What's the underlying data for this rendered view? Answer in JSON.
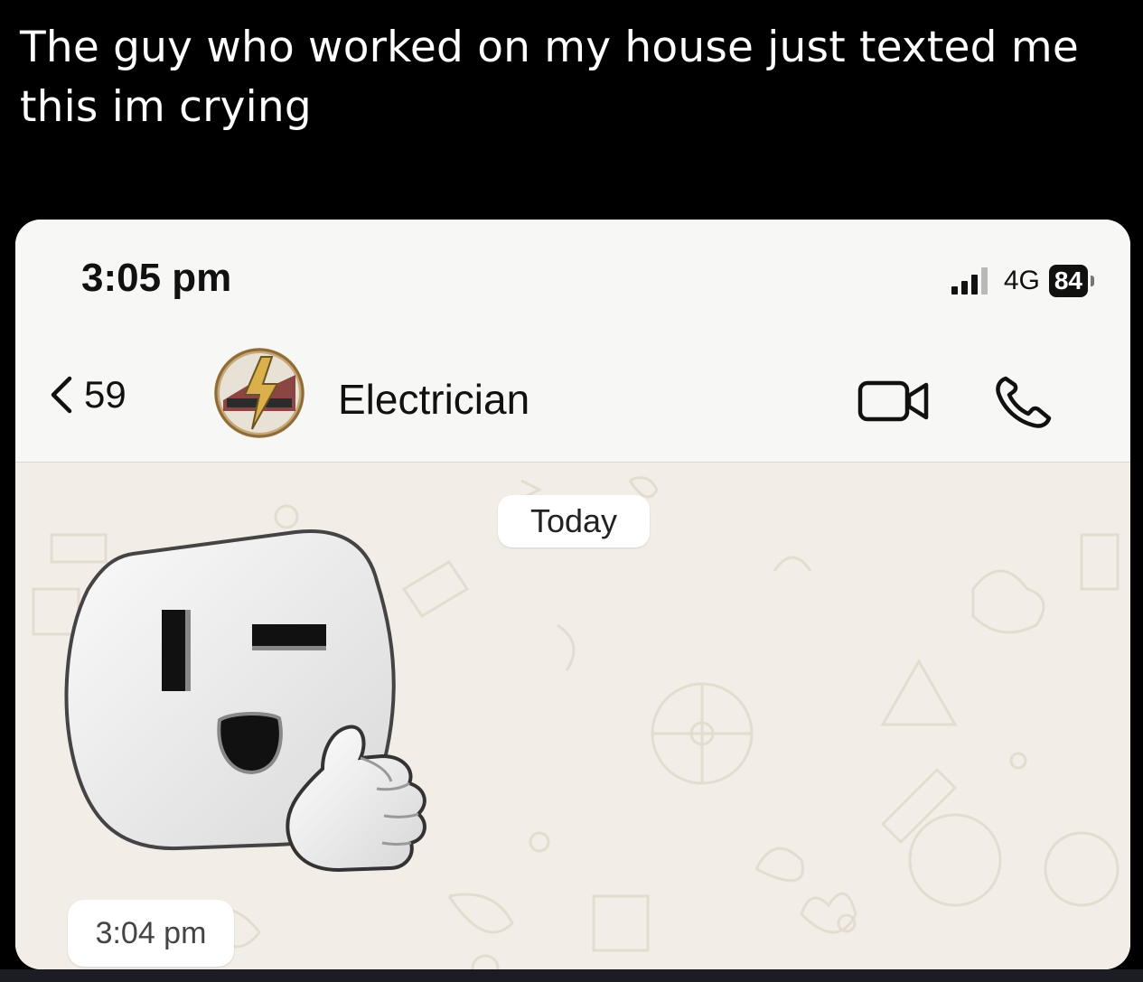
{
  "caption": "The guy who worked on my house just texted me this im crying",
  "status_bar": {
    "time": "3:05 pm",
    "network": "4G",
    "battery": "84",
    "signal_bars_filled": 3,
    "signal_bars_total": 4
  },
  "chat_header": {
    "back_icon": "chevron-left-icon",
    "unread_count": "59",
    "contact_name": "Electrician",
    "avatar_icon": "electrician-logo-avatar",
    "video_call_icon": "video-camera-icon",
    "voice_call_icon": "phone-icon"
  },
  "conversation": {
    "date_divider": "Today",
    "messages": [
      {
        "type": "sticker",
        "sticker": "winking-outlet-thumbs-up-sticker",
        "time": "3:04 pm"
      }
    ]
  },
  "colors": {
    "header_bg": "#f7f8f5",
    "chat_bg": "#f2eee7",
    "bubble_bg": "#ffffff",
    "page_bg": "#000000"
  }
}
